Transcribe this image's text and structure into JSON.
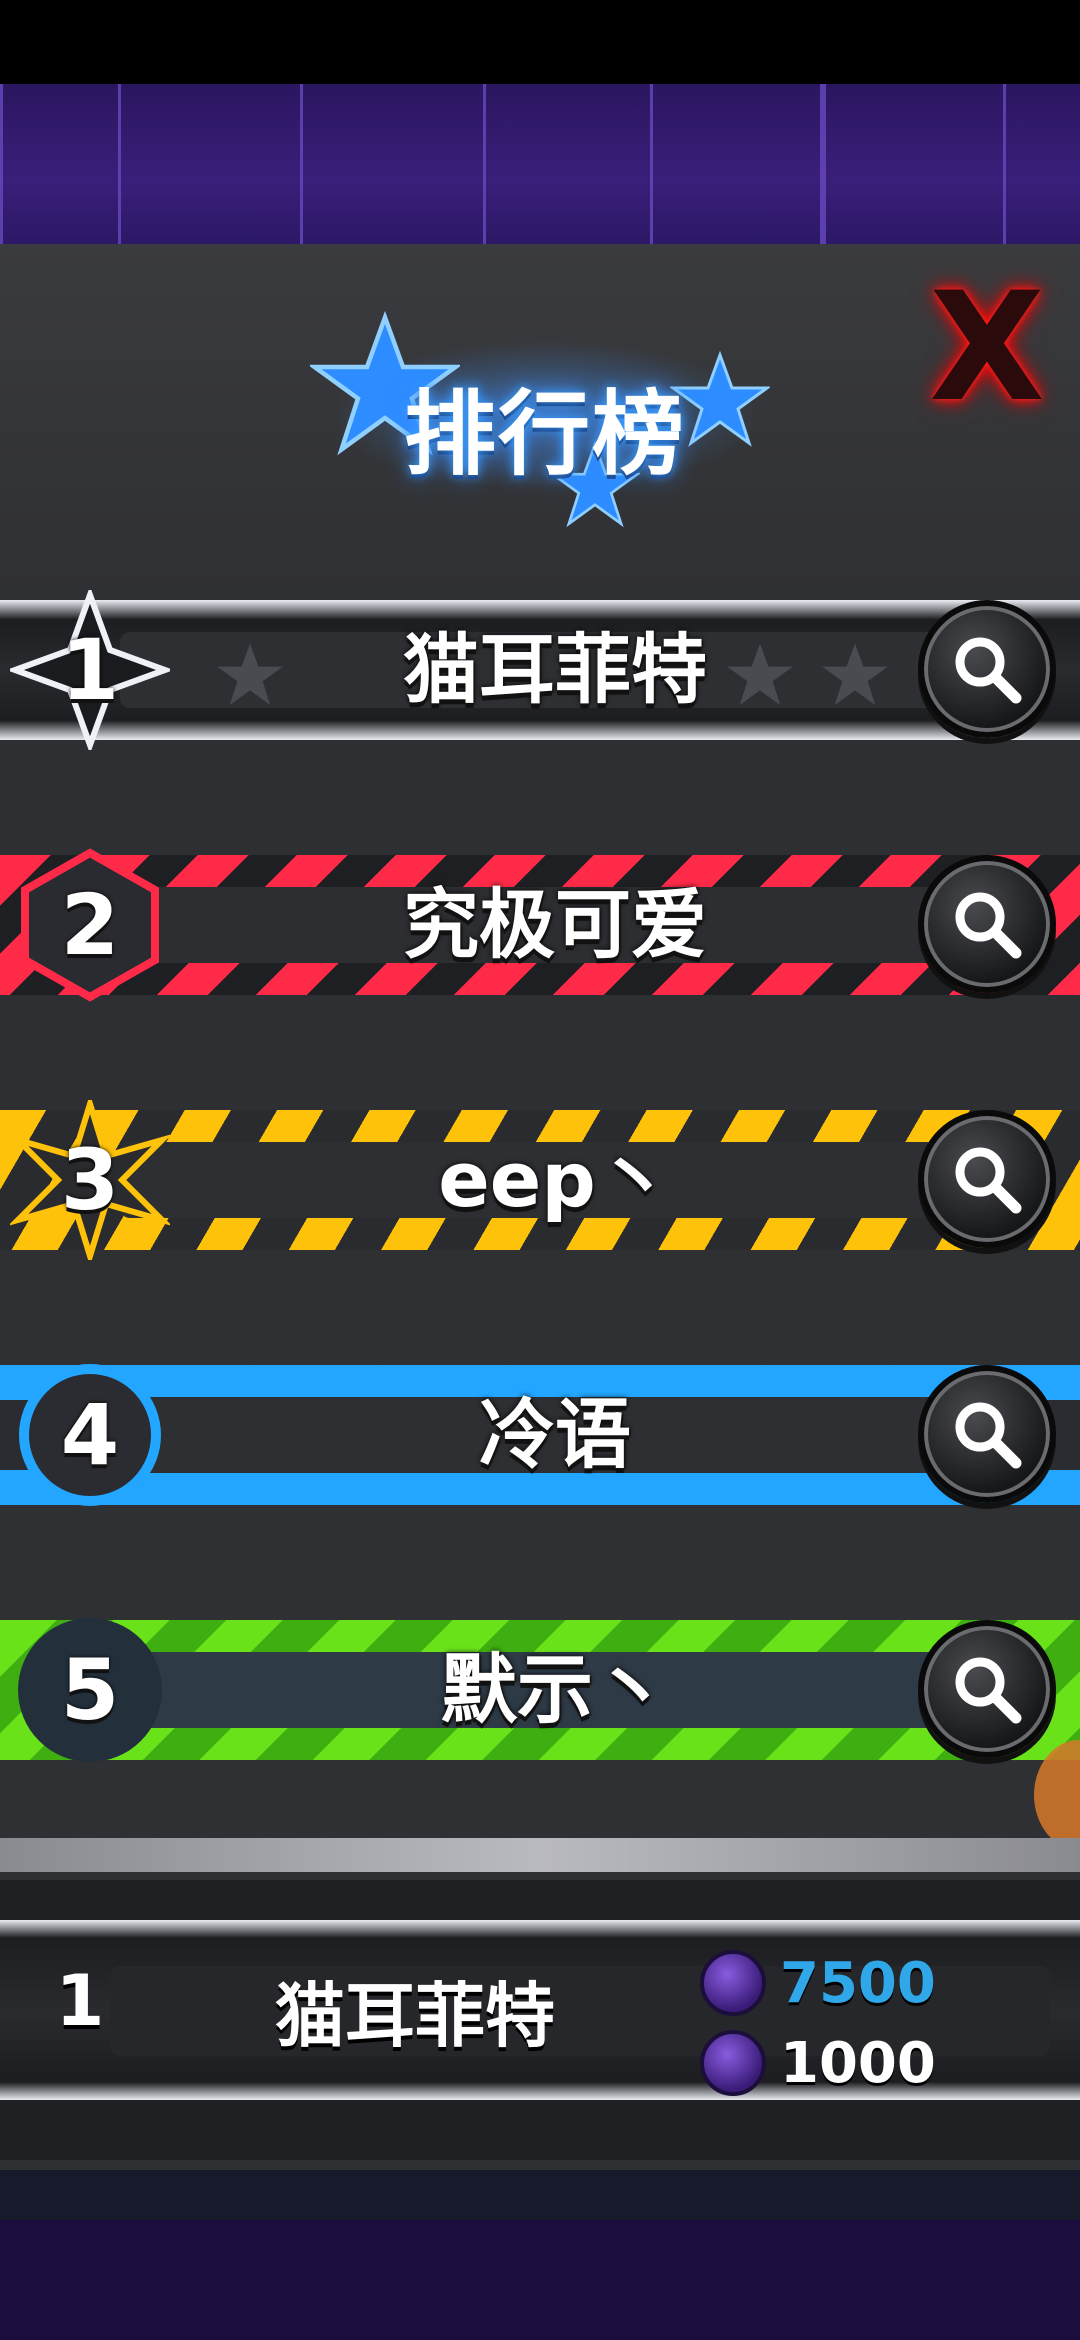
{
  "header": {
    "title": "排行榜",
    "close_label": "X"
  },
  "leaderboard": [
    {
      "rank": "1",
      "name": "猫耳菲特",
      "theme": "white-black",
      "accent": "#d9dde3"
    },
    {
      "rank": "2",
      "name": "究极可爱",
      "theme": "red",
      "accent": "#ff2a48"
    },
    {
      "rank": "3",
      "name": "eep丶",
      "theme": "yellow",
      "accent": "#ffc20a"
    },
    {
      "rank": "4",
      "name": "冷语",
      "theme": "blue",
      "accent": "#22a6ff"
    },
    {
      "rank": "5",
      "name": "默示丶",
      "theme": "green",
      "accent": "#6ae21a"
    }
  ],
  "my_entry": {
    "rank": "1",
    "name": "猫耳菲特",
    "currency_1": {
      "value": "7500",
      "icon": "shield-coin-icon",
      "color": "#2fa7e8"
    },
    "currency_2": {
      "value": "1000",
      "icon": "gem-coin-icon",
      "color": "#ffffff"
    }
  },
  "icons": {
    "search": "magnifier-icon",
    "close": "close-x-icon"
  }
}
